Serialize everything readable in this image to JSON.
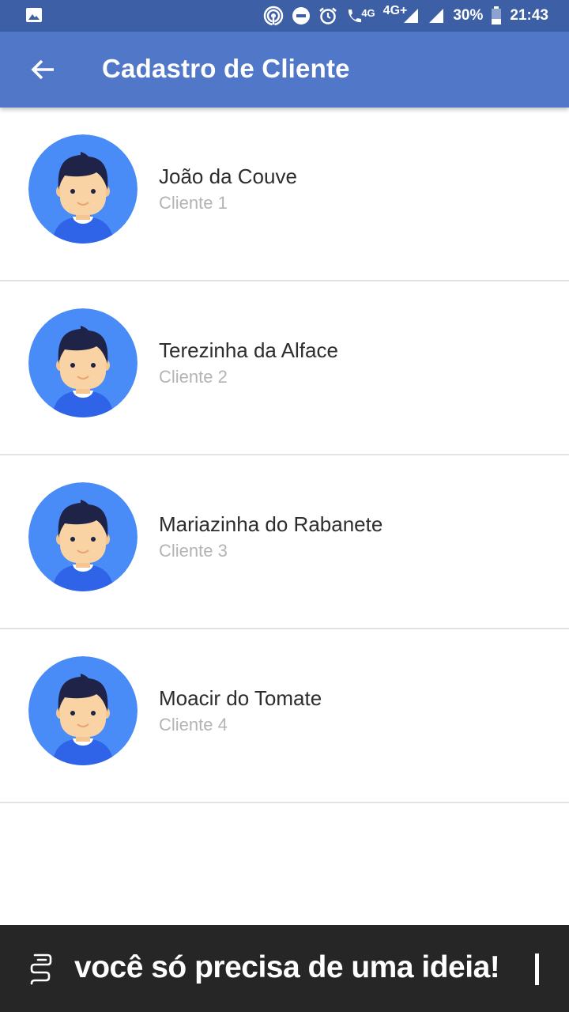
{
  "status_bar": {
    "battery": "30%",
    "time": "21:43",
    "network_small": "4G",
    "network_main": "4G+",
    "icons": [
      "image-icon",
      "hotspot-icon",
      "do-not-disturb-icon",
      "alarm-icon",
      "volte-call-icon",
      "signal-icon",
      "signal-icon",
      "battery-icon"
    ]
  },
  "app_bar": {
    "title": "Cadastro de Cliente",
    "back_icon": "arrow-left-icon",
    "color": "#5177c9"
  },
  "clients": [
    {
      "name": "João da Couve",
      "subtitle": "Cliente 1"
    },
    {
      "name": "Terezinha da Alface",
      "subtitle": "Cliente 2"
    },
    {
      "name": "Mariazinha do Rabanete",
      "subtitle": "Cliente 3"
    },
    {
      "name": "Moacir do Tomate",
      "subtitle": "Cliente 4"
    }
  ],
  "banner": {
    "text": "você só precisa de uma ideia!",
    "background": "#262626"
  },
  "colors": {
    "status_bar": "#3c5fa5",
    "avatar_bg": "#4a8cf7",
    "divider": "#e2e2e2"
  }
}
